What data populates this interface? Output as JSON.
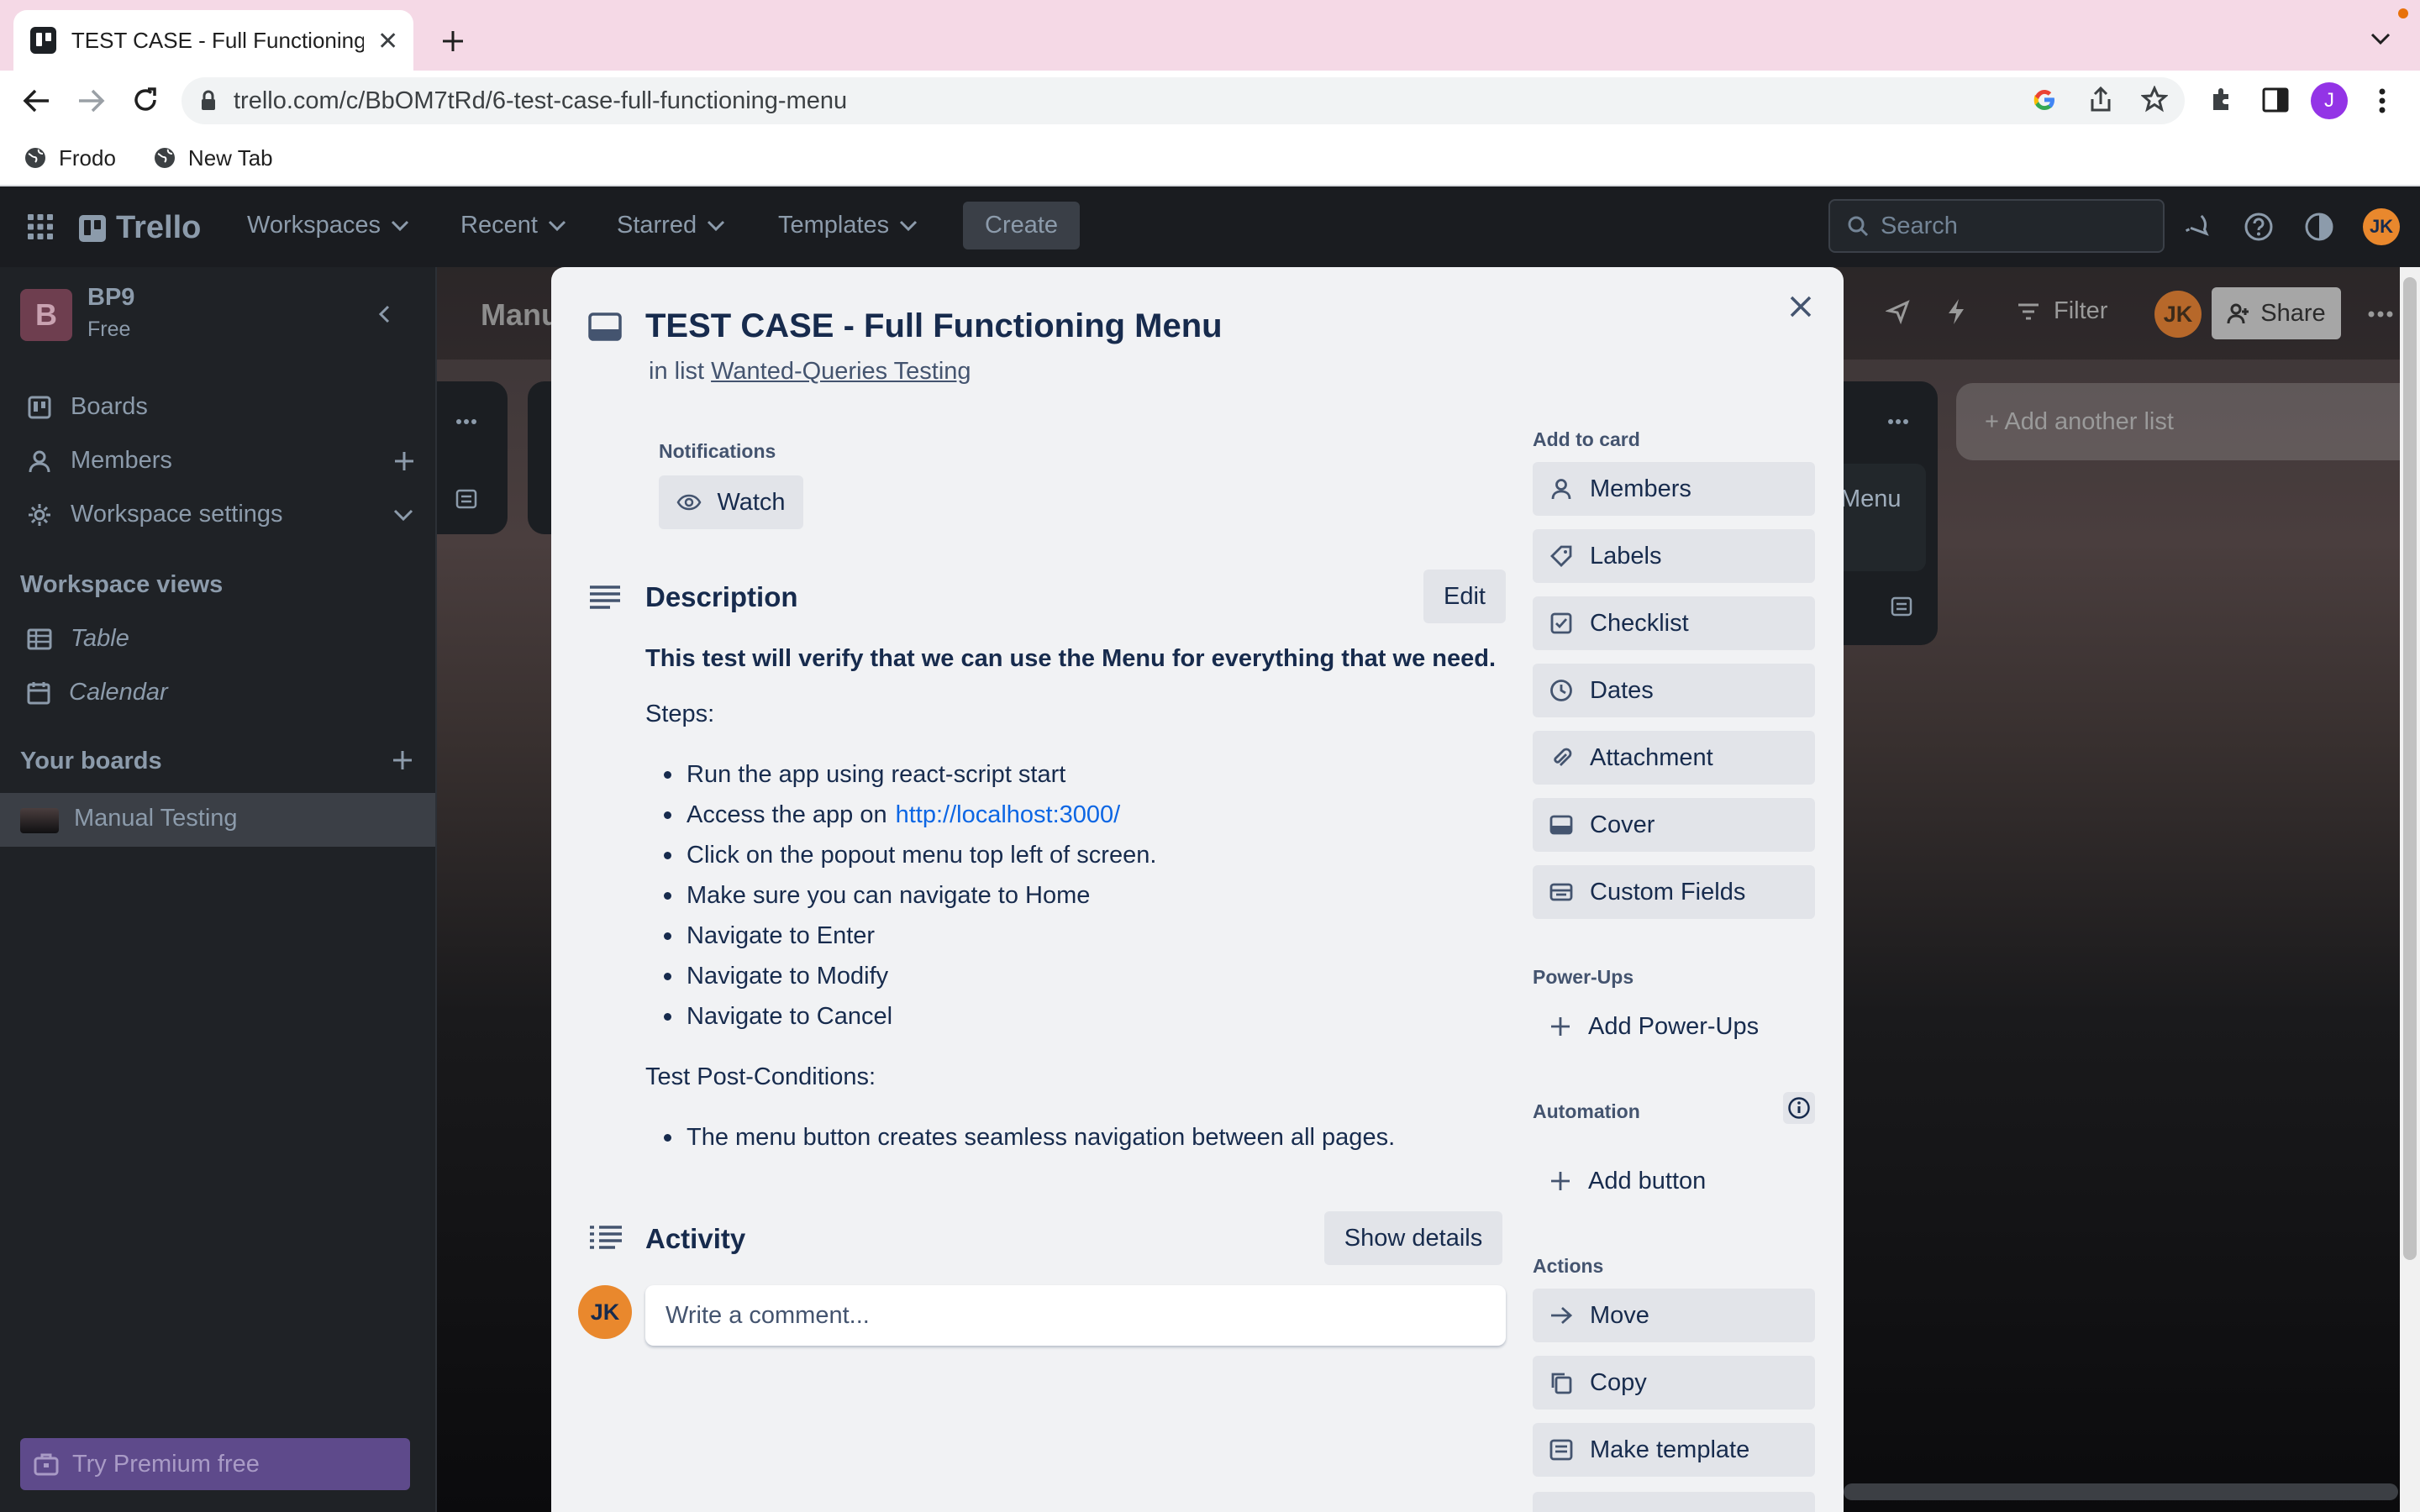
{
  "browser": {
    "tab_title": "TEST CASE - Full Functioning I",
    "url": "trello.com/c/BbOM7tRd/6-test-case-full-functioning-menu",
    "bookmarks": [
      {
        "label": "Frodo"
      },
      {
        "label": "New Tab"
      }
    ],
    "profile_initial": "J"
  },
  "header": {
    "logo": "Trello",
    "nav": [
      {
        "label": "Workspaces"
      },
      {
        "label": "Recent"
      },
      {
        "label": "Starred"
      },
      {
        "label": "Templates"
      }
    ],
    "create_label": "Create",
    "search_placeholder": "Search",
    "avatar_initials": "JK"
  },
  "sidebar": {
    "workspace_initial": "B",
    "workspace_name": "BP9",
    "workspace_plan": "Free",
    "items": [
      {
        "label": "Boards"
      },
      {
        "label": "Members"
      },
      {
        "label": "Workspace settings"
      }
    ],
    "views_heading": "Workspace views",
    "views": [
      {
        "label": "Table"
      },
      {
        "label": "Calendar"
      }
    ],
    "boards_heading": "Your boards",
    "boards": [
      {
        "label": "Manual Testing"
      }
    ],
    "premium_label": "Try Premium free"
  },
  "board": {
    "title_partial": "Manu",
    "filter_label": "Filter",
    "share_label": "Share",
    "avatar_initials": "JK",
    "add_list_label": "+ Add another list",
    "card_partial": "Menu"
  },
  "modal": {
    "title": "TEST CASE - Full Functioning Menu",
    "in_list_prefix": "in list",
    "list_name": "Wanted-Queries Testing",
    "notifications_label": "Notifications",
    "watch_label": "Watch",
    "description_heading": "Description",
    "edit_label": "Edit",
    "description": {
      "intro": "This test will verify that we can use the Menu for everything that we need.",
      "steps_label": "Steps:",
      "steps": [
        "Run the app using react-script start",
        "Access the app on",
        "Click on the popout menu top left of screen.",
        "Make sure you can navigate to Home",
        "Navigate to Enter",
        "Navigate to Modify",
        "Navigate to Cancel"
      ],
      "link": "http://localhost:3000/",
      "post_label": "Test Post-Conditions:",
      "post": [
        "The menu button creates seamless navigation between all pages."
      ]
    },
    "activity_heading": "Activity",
    "show_details_label": "Show details",
    "comment_placeholder": "Write a comment...",
    "commenter_initials": "JK",
    "add_to_card_heading": "Add to card",
    "add_to_card": [
      {
        "label": "Members",
        "icon": "person-icon"
      },
      {
        "label": "Labels",
        "icon": "tag-icon"
      },
      {
        "label": "Checklist",
        "icon": "checkbox-icon"
      },
      {
        "label": "Dates",
        "icon": "clock-icon"
      },
      {
        "label": "Attachment",
        "icon": "paperclip-icon"
      },
      {
        "label": "Cover",
        "icon": "cover-icon"
      },
      {
        "label": "Custom Fields",
        "icon": "fields-icon"
      }
    ],
    "powerups_heading": "Power-Ups",
    "add_powerups_label": "Add Power-Ups",
    "automation_heading": "Automation",
    "add_button_label": "Add button",
    "actions_heading": "Actions",
    "actions": [
      {
        "label": "Move",
        "icon": "arrow-right-icon"
      },
      {
        "label": "Copy",
        "icon": "copy-icon"
      },
      {
        "label": "Make template",
        "icon": "template-icon"
      }
    ]
  },
  "colors": {
    "accent_link": "#0c66e4",
    "avatar_orange": "#e9882d",
    "modal_bg": "#f1f2f4"
  }
}
